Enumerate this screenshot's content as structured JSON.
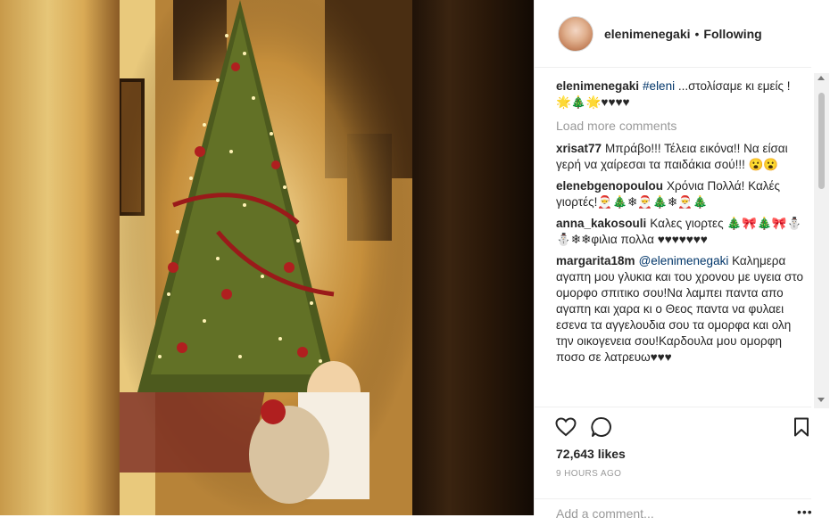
{
  "header": {
    "username": "elenimenegaki",
    "separator": "•",
    "follow_status": "Following"
  },
  "caption": {
    "username": "elenimenegaki",
    "hashtag": "#eleni",
    "text": " ...στολίσαμε κι εμείς !",
    "emoji": "🌟🎄🌟♥♥♥♥"
  },
  "load_more": "Load more comments",
  "comments": [
    {
      "username": "xrisat77",
      "mention": "",
      "text": "Μπράβο!!! Τέλεια εικόνα!! Να είσαι γερή να χαίρεσαι τα παιδάκια σού!!! 😮😮"
    },
    {
      "username": "elenebgenopoulou",
      "mention": "",
      "text": "Χρόνια Πολλά! Καλές γιορτές!🎅🎄❄🎅🎄❄🎅🎄"
    },
    {
      "username": "anna_kakosouli",
      "mention": "",
      "text": "Καλες γιορτες 🎄🎀🎄🎀⛄⛄❄❄φιλια πολλα ♥♥♥♥♥♥♥"
    },
    {
      "username": "margarita18m",
      "mention": "@elenimenegaki",
      "text": " Καλημερα αγαπη μου γλυκια και του χρονου με υγεια στο ομορφο σπιτικο σου!Να λαμπει παντα απο αγαπη και χαρα κι ο Θεος παντα να φυλαει εσενα τα αγγελουδια σου τα ομορφα και ολη την οικογενεια σου!Καρδουλα μου ομορφη ποσο σε λατρευω♥♥♥"
    }
  ],
  "likes": "72,643 likes",
  "timestamp": "9 HOURS AGO",
  "add_comment_placeholder": "Add a comment...",
  "more_options": "•••",
  "icons": [
    "heart-icon",
    "comment-icon",
    "bookmark-icon"
  ]
}
